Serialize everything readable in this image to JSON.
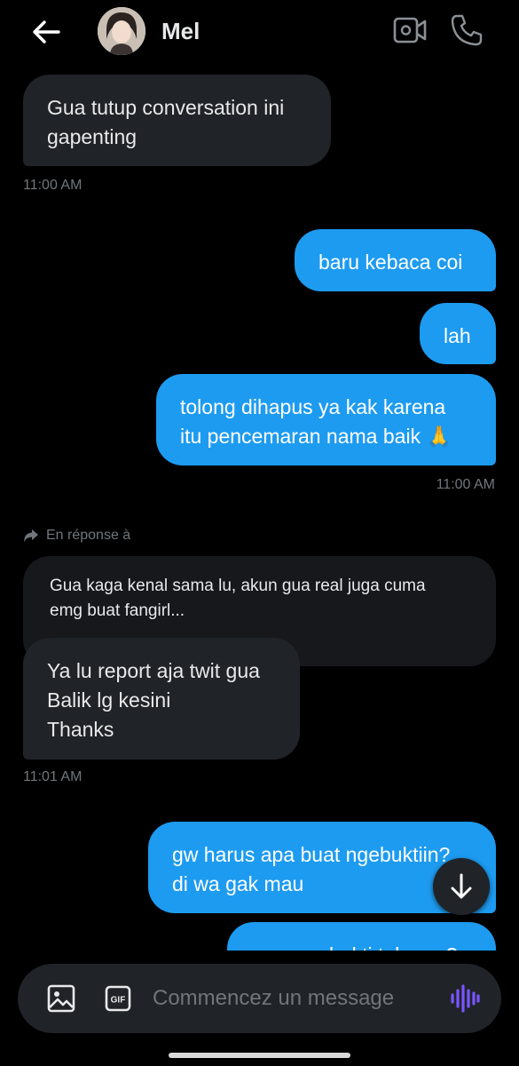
{
  "header": {
    "contact_name": "Mel",
    "back_icon": "arrow-left-icon",
    "video_icon": "video-call-icon",
    "call_icon": "phone-icon"
  },
  "messages": [
    {
      "direction": "in",
      "text": "Gua tutup conversation ini\ngapenting"
    },
    {
      "direction": "out",
      "text": "baru kebaca coi"
    },
    {
      "direction": "out",
      "text": "lah"
    },
    {
      "direction": "out",
      "text": "tolong dihapus ya kak karena\nitu pencemaran nama baik 🙏"
    },
    {
      "direction": "in",
      "text": "Ya lu report aja twit gua\nBalik lg kesini\nThanks"
    },
    {
      "direction": "out",
      "text": "gw harus apa buat ngebuktiin?\ndi wa gak mau"
    },
    {
      "direction": "out",
      "text": "bukti tuh apa?"
    }
  ],
  "timestamps": [
    "11:00 AM",
    "11:00 AM",
    "11:01 AM"
  ],
  "reply": {
    "label": "En réponse à",
    "quoted_text": "Gua kaga kenal sama lu, akun gua real juga cuma\nemg buat fangirl..."
  },
  "composer": {
    "placeholder": "Commencez un message",
    "gif_label": "GIF"
  },
  "colors": {
    "accent": "#1d9bf0",
    "incoming_bubble": "#202327",
    "voice_icon": "#7856ff",
    "muted_text": "#71767b"
  }
}
